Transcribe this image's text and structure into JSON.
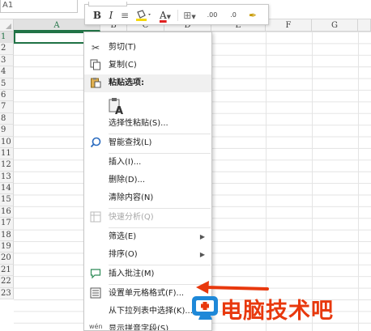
{
  "name_box": {
    "value": "A1"
  },
  "columns": [
    "A",
    "B",
    "C",
    "D",
    "E",
    "F",
    "G"
  ],
  "rows": [
    "1",
    "2",
    "3",
    "4",
    "5",
    "6",
    "7",
    "8",
    "9",
    "10",
    "11",
    "12",
    "13",
    "14",
    "15",
    "16",
    "17",
    "18",
    "19",
    "20",
    "21",
    "22",
    "23"
  ],
  "mini_toolbar": {
    "bold": "B",
    "italic": "I",
    "align": "≡",
    "font_color": "A",
    "border": "⊞",
    "inc_decimal": ".00",
    "dec_decimal": ".0",
    "format_painter": "✒"
  },
  "context_menu": {
    "cut": "剪切(T)",
    "copy": "复制(C)",
    "paste_options": "粘贴选项:",
    "paste_special": "选择性粘贴(S)...",
    "smart_lookup": "智能查找(L)",
    "insert": "插入(I)...",
    "delete": "删除(D)...",
    "clear_contents": "清除内容(N)",
    "quick_analysis": "快速分析(Q)",
    "filter": "筛选(E)",
    "sort": "排序(O)",
    "insert_comment": "插入批注(M)",
    "format_cells": "设置单元格格式(F)...",
    "pick_from_list": "从下拉列表中选择(K)...",
    "show_phonetic": "显示拼音字段(S)"
  },
  "watermark": {
    "text": "电脑技术吧"
  },
  "colors": {
    "accent_green": "#217346",
    "annotation_red": "#e8380d",
    "watermark_blue": "#1e88d8"
  }
}
